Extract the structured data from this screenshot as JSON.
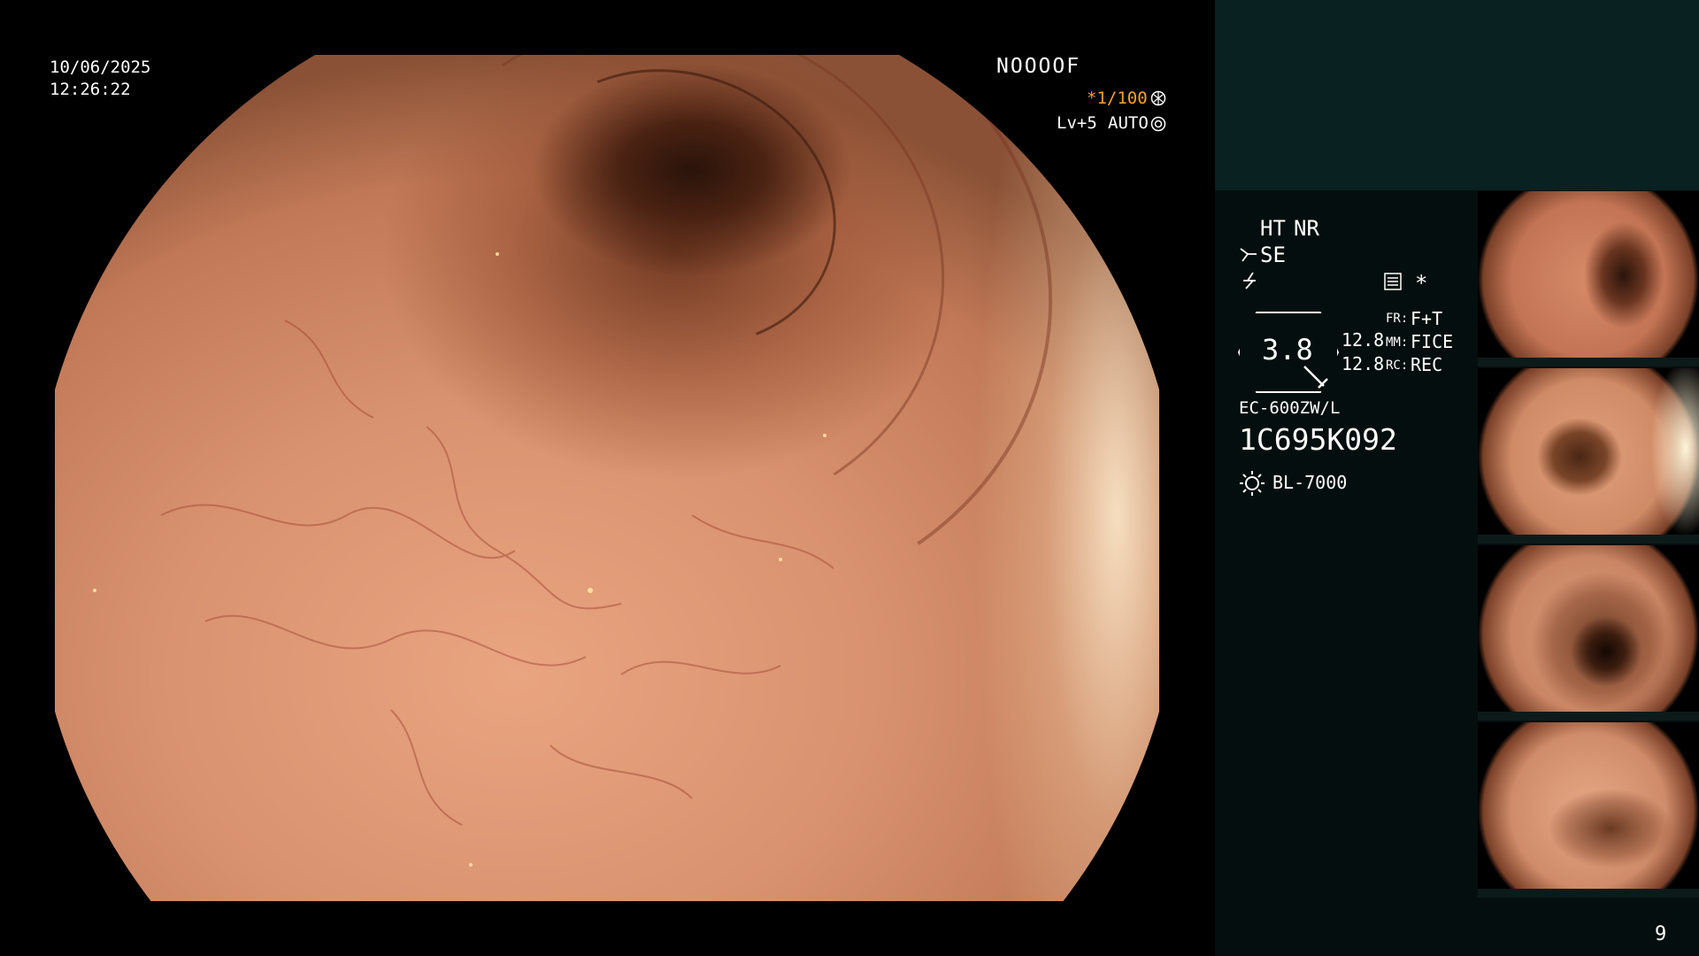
{
  "overlay": {
    "date": "10/06/2025",
    "time": "12:26:22",
    "patient_code": "NOOOOF",
    "shutter": "*1/100",
    "level": "Lv+5",
    "mode": "AUTO"
  },
  "panel": {
    "ht": "HT",
    "nr": "NR",
    "se": "SE",
    "zoom_value": "3.8",
    "fr_label": "FR:",
    "fr_value": "F+T",
    "mm_label": "MM:",
    "mm_value": "FICE",
    "rc_label": "RC:",
    "rc_value": "REC",
    "val1": "12.8",
    "val2": "12.8",
    "scope_model": "EC-600ZW/L",
    "serial": "1C695K092",
    "light_source": "BL-7000",
    "page_number": "9"
  },
  "colors": {
    "accent": "#ffa033",
    "panel_top": "#0a2121",
    "panel_bg": "#050e0e"
  },
  "icons": [
    "shutter-icon",
    "auto-iris-icon",
    "scissors-icon",
    "flash-icon",
    "grid-icon",
    "asterisk-icon",
    "lamp-icon"
  ]
}
